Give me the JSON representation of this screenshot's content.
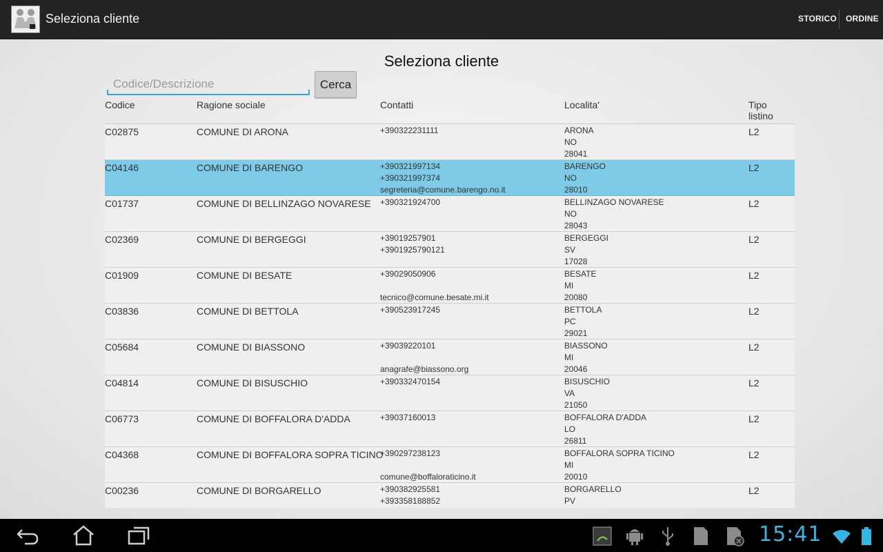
{
  "action_bar": {
    "title": "Seleziona cliente",
    "actions": [
      "STORICO",
      "ORDINE"
    ]
  },
  "page_title": "Seleziona cliente",
  "search": {
    "placeholder": "Codice/Descrizione",
    "value": "",
    "button_label": "Cerca"
  },
  "columns": [
    "Codice",
    "Ragione sociale",
    "Contatti",
    "Localita'",
    "Tipo\nlistino"
  ],
  "selected_code": "C04146",
  "rows": [
    {
      "code": "C02875",
      "name": "COMUNE DI ARONA",
      "contacts": [
        "+390322231111",
        "",
        ""
      ],
      "city": "ARONA",
      "prov": "NO",
      "cap": "28041",
      "tipo": "L2"
    },
    {
      "code": "C04146",
      "name": "COMUNE DI BARENGO",
      "contacts": [
        "+390321997134",
        "+390321997374",
        "segreteria@comune.barengo.no.it"
      ],
      "city": "BARENGO",
      "prov": "NO",
      "cap": "28010",
      "tipo": "L2"
    },
    {
      "code": "C01737",
      "name": "COMUNE DI BELLINZAGO NOVARESE",
      "contacts": [
        "+390321924700",
        "",
        ""
      ],
      "city": "BELLINZAGO NOVARESE",
      "prov": "NO",
      "cap": "28043",
      "tipo": "L2"
    },
    {
      "code": "C02369",
      "name": "COMUNE DI BERGEGGI",
      "contacts": [
        "+39019257901",
        "+3901925790121",
        ""
      ],
      "city": "BERGEGGI",
      "prov": "SV",
      "cap": "17028",
      "tipo": "L2"
    },
    {
      "code": "C01909",
      "name": "COMUNE DI BESATE",
      "contacts": [
        "+39029050906",
        "",
        "tecnico@comune.besate.mi.it"
      ],
      "city": "BESATE",
      "prov": "MI",
      "cap": "20080",
      "tipo": "L2"
    },
    {
      "code": "C03836",
      "name": "COMUNE DI BETTOLA",
      "contacts": [
        "+390523917245",
        "",
        ""
      ],
      "city": "BETTOLA",
      "prov": "PC",
      "cap": "29021",
      "tipo": "L2"
    },
    {
      "code": "C05684",
      "name": "COMUNE DI BIASSONO",
      "contacts": [
        "+39039220101",
        "",
        "anagrafe@biassono.org"
      ],
      "city": "BIASSONO",
      "prov": "MI",
      "cap": "20046",
      "tipo": "L2"
    },
    {
      "code": "C04814",
      "name": "COMUNE DI BISUSCHIO",
      "contacts": [
        "+390332470154",
        "",
        ""
      ],
      "city": "BISUSCHIO",
      "prov": "VA",
      "cap": "21050",
      "tipo": "L2"
    },
    {
      "code": "C06773",
      "name": "COMUNE DI BOFFALORA D'ADDA",
      "contacts": [
        "+39037160013",
        "",
        ""
      ],
      "city": "BOFFALORA D'ADDA",
      "prov": "LO",
      "cap": "26811",
      "tipo": "L2"
    },
    {
      "code": "C04368",
      "name": "COMUNE DI BOFFALORA SOPRA TICINO",
      "contacts": [
        "+390297238123",
        "",
        "comune@boffaloraticino.it"
      ],
      "city": "BOFFALORA SOPRA TICINO",
      "prov": "MI",
      "cap": "20010",
      "tipo": "L2"
    },
    {
      "code": "C00236",
      "name": "COMUNE DI BORGARELLO",
      "contacts": [
        "+390382925581",
        "+393358188852",
        ""
      ],
      "city": "BORGARELLO",
      "prov": "PV",
      "cap": "",
      "tipo": "L2"
    }
  ],
  "status_bar": {
    "time": "15:41"
  },
  "nav_icons": [
    "back-icon",
    "home-icon",
    "recent-apps-icon"
  ],
  "system_icons": [
    "screenshot-icon",
    "android-debug-icon",
    "usb-icon",
    "sd-card-icon",
    "sd-card-removed-icon",
    "wifi-icon",
    "battery-icon"
  ],
  "colors": {
    "accent": "#33b5e5",
    "selection": "#7ecbe8",
    "action_bar": "#232323"
  }
}
